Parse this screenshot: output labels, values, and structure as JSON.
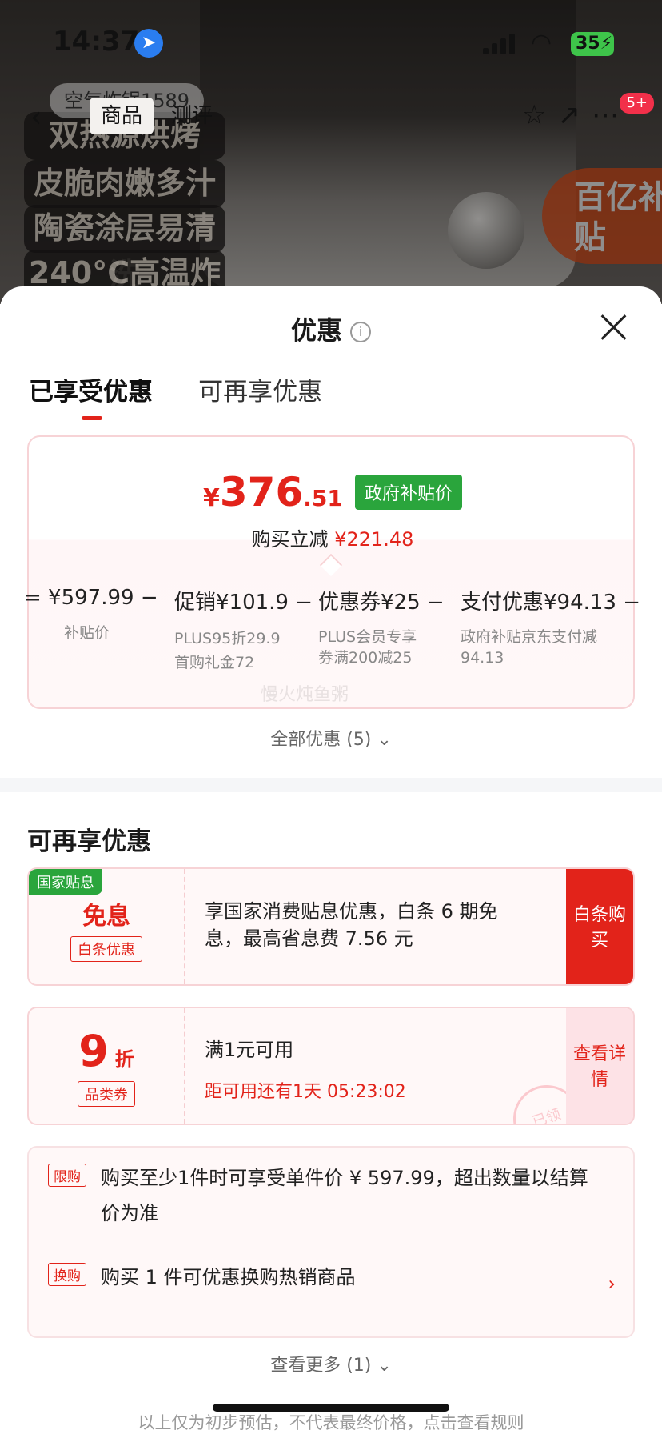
{
  "status_bar": {
    "time": "14:37",
    "location_icon": "location-arrow-icon",
    "battery": "35"
  },
  "nav": {
    "tabs": [
      "商品",
      "测评"
    ],
    "search_stub": "空气炸锅1589",
    "badge": "5+"
  },
  "background": {
    "promo_lines": [
      "双热源烘烤",
      "皮脆肉嫩多汁",
      "陶瓷涂层易清洗",
      "240°C高温炸"
    ],
    "subsidy_badge": "百亿补贴"
  },
  "sheet": {
    "title": "优惠",
    "tabs": {
      "active": "已享受优惠",
      "inactive": "可再享优惠"
    }
  },
  "price_card": {
    "currency": "¥",
    "price_int": "376",
    "price_dec": ".51",
    "price_badge": "政府补贴价",
    "reduce_label": "购买立减",
    "reduce_value": "¥221.48",
    "formula": [
      {
        "main": "= ¥597.99 −",
        "subs": [
          "补贴价"
        ]
      },
      {
        "main": "促销¥101.9 −",
        "subs": [
          "PLUS95折29.9",
          "首购礼金72"
        ]
      },
      {
        "main": "优惠券¥25 −",
        "subs": [
          "PLUS会员专享券满200减25"
        ]
      },
      {
        "main": "支付优惠¥94.13 −",
        "subs": [
          "政府补贴京东支付减94.13"
        ]
      }
    ],
    "watermark": "慢火炖鱼粥"
  },
  "all_promo": "全部优惠 (5) ⌄",
  "more_section": {
    "title": "可再享优惠",
    "offer1": {
      "tag": "国家贴息",
      "big": "免息",
      "sub": "白条优惠",
      "text": "享国家消费贴息优惠，白条 6 期免息，最高省息费 7.56 元",
      "button": "白条购买"
    },
    "offer2": {
      "big": "9",
      "unit": "折",
      "sub": "品类券",
      "title": "满1元可用",
      "timer": "距可用还有1天 05:23:02",
      "stamp": "已领",
      "button": "查看详情"
    }
  },
  "rules": [
    {
      "tag": "限购",
      "text": "购买至少1件时可享受单件价 ¥ 597.99，超出数量以结算价为准"
    },
    {
      "tag": "换购",
      "text": "购买 1 件可优惠换购热销商品"
    }
  ],
  "see_more": "查看更多 (1) ⌄",
  "footer_note": "以上仅为初步预估，不代表最终价格，点击查看规则",
  "colors": {
    "accent_red": "#e2231a",
    "green": "#2aa53c",
    "card_border": "#f7d3d6"
  }
}
